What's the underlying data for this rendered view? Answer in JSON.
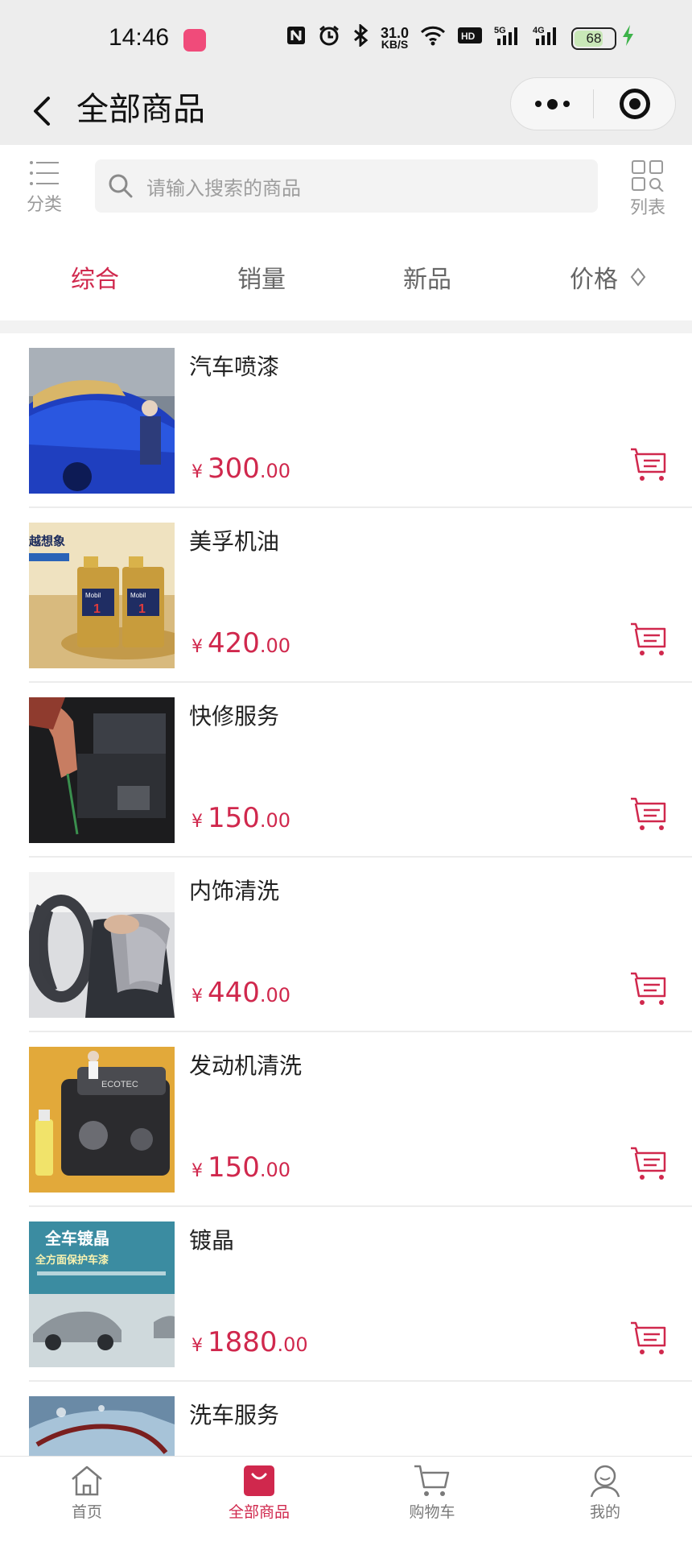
{
  "status_bar": {
    "time": "14:46",
    "speed_value": "31.0",
    "speed_unit": "KB/S",
    "battery": "68",
    "icons": [
      "nfc-icon",
      "alarm-icon",
      "bluetooth-icon",
      "wifi-icon",
      "hd-icon",
      "5g-signal-icon",
      "4g-signal-icon",
      "battery-icon",
      "charging-icon"
    ]
  },
  "header": {
    "title": "全部商品"
  },
  "search": {
    "category_label": "分类",
    "placeholder": "请输入搜索的商品",
    "list_label": "列表"
  },
  "sort_tabs": [
    {
      "label": "综合",
      "active": true
    },
    {
      "label": "销量",
      "active": false
    },
    {
      "label": "新品",
      "active": false
    },
    {
      "label": "价格",
      "active": false
    }
  ],
  "products": [
    {
      "name": "汽车喷漆",
      "currency": "¥",
      "price_int": "300",
      "price_dec": ".00"
    },
    {
      "name": "美孚机油",
      "currency": "¥",
      "price_int": "420",
      "price_dec": ".00"
    },
    {
      "name": "快修服务",
      "currency": "¥",
      "price_int": "150",
      "price_dec": ".00"
    },
    {
      "name": "内饰清洗",
      "currency": "¥",
      "price_int": "440",
      "price_dec": ".00"
    },
    {
      "name": "发动机清洗",
      "currency": "¥",
      "price_int": "150",
      "price_dec": ".00"
    },
    {
      "name": "镀晶",
      "currency": "¥",
      "price_int": "1880",
      "price_dec": ".00"
    },
    {
      "name": "洗车服务",
      "currency": "",
      "price_int": "",
      "price_dec": ""
    }
  ],
  "product_images": {
    "oil_brand_text": "越想象",
    "oil_label": "Mobil",
    "oil_number": "1",
    "engine_text": "ECOTEC",
    "coating_title": "全车镀晶",
    "coating_subtitle": "全方面保护车漆"
  },
  "tab_bar": [
    {
      "label": "首页",
      "active": false
    },
    {
      "label": "全部商品",
      "active": true
    },
    {
      "label": "购物车",
      "active": false
    },
    {
      "label": "我的",
      "active": false
    }
  ],
  "colors": {
    "accent": "#d0284d",
    "header_bg": "#ededed",
    "muted_text": "#9a9a9a"
  }
}
